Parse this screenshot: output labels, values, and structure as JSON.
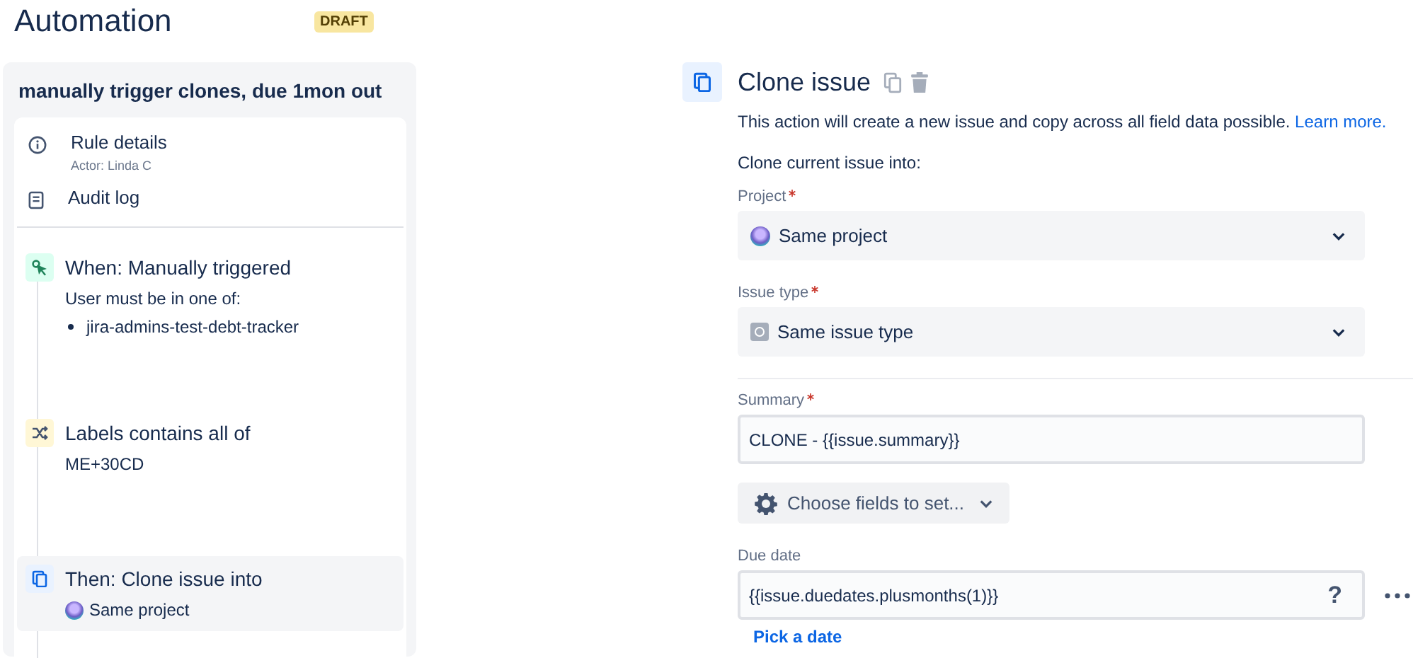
{
  "page": {
    "title": "Automation",
    "badge": "DRAFT"
  },
  "rule": {
    "name": "manually trigger clones, due 1mon out",
    "menu": [
      {
        "kind": "info",
        "label": "Rule details",
        "sub": "Actor: Linda C"
      },
      {
        "kind": "log",
        "label": "Audit log"
      }
    ],
    "steps": [
      {
        "kind": "trigger",
        "title": "When: Manually triggered",
        "text": "User must be in one of:",
        "bullets": [
          "jira-admins-test-debt-tracker"
        ],
        "selected": false
      },
      {
        "kind": "condition",
        "title": "Labels contains all of",
        "text": "ME+30CD",
        "selected": false
      },
      {
        "kind": "action",
        "title": "Then: Clone issue into",
        "project": "Same project",
        "selected": true
      }
    ]
  },
  "editor": {
    "title": "Clone issue",
    "description": "This action will create a new issue and copy across all field data possible.",
    "link": "Learn more.",
    "intro": "Clone current issue into:",
    "selects": [
      {
        "kind": "project",
        "label": "Project",
        "required": true,
        "value": "Same project"
      },
      {
        "kind": "issuetype",
        "label": "Issue type",
        "required": true,
        "value": "Same issue type"
      }
    ],
    "summary": {
      "label": "Summary",
      "required": true,
      "value": "CLONE - {{issue.summary}}"
    },
    "fields_button": "Choose fields to set...",
    "due_date": {
      "label": "Due date",
      "required": false,
      "value": "{{issue.duedates.plusmonths(1)}}",
      "help": "?",
      "link": "Pick a date"
    }
  }
}
